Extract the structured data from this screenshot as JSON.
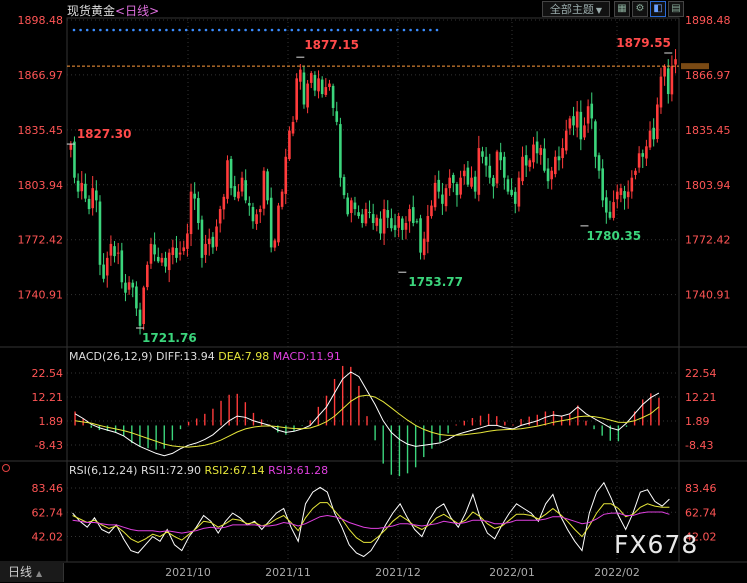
{
  "header": {
    "title": "现货黄金",
    "period": "<日线>",
    "theme_button": "全部主题",
    "bottom_tab": "日线"
  },
  "watermark": "FX678",
  "colors": {
    "up": "#ff3b3b",
    "down": "#3bd57c",
    "axis_text": "#ff5555",
    "grid": "#333333",
    "dif": "#ffffff",
    "dea": "#e6e63a",
    "macd": "#e040e0",
    "rsi1": "#ffffff",
    "rsi2": "#e6e63a",
    "rsi3": "#e040e0",
    "ref_line": "#ff9a3a",
    "dots": "#3a8cff"
  },
  "chart_data": [
    {
      "type": "candlestick",
      "title": "现货黄金",
      "period": "日线",
      "y_ticks": [
        "1898.48",
        "1866.97",
        "1835.45",
        "1803.94",
        "1772.42",
        "1740.91"
      ],
      "ylim": [
        1712,
        1898.48
      ],
      "x_ticks": [
        "2021/10",
        "2021/11",
        "2021/12",
        "2022/01",
        "2022/02"
      ],
      "current_price_line": 1872,
      "annotations": [
        {
          "text": "1827.30",
          "kind": "high"
        },
        {
          "text": "1877.15",
          "kind": "high"
        },
        {
          "text": "1879.55",
          "kind": "high"
        },
        {
          "text": "1721.76",
          "kind": "low"
        },
        {
          "text": "1753.77",
          "kind": "low"
        },
        {
          "text": "1780.35",
          "kind": "low"
        }
      ],
      "closes": [
        1827,
        1808,
        1800,
        1805,
        1796,
        1790,
        1802,
        1795,
        1758,
        1750,
        1762,
        1770,
        1763,
        1765,
        1748,
        1742,
        1748,
        1745,
        1733,
        1723,
        1745,
        1758,
        1770,
        1764,
        1760,
        1762,
        1757,
        1765,
        1768,
        1762,
        1765,
        1768,
        1776,
        1800,
        1796,
        1782,
        1762,
        1770,
        1773,
        1768,
        1780,
        1790,
        1797,
        1818,
        1802,
        1797,
        1800,
        1808,
        1795,
        1792,
        1783,
        1787,
        1790,
        1812,
        1795,
        1768,
        1772,
        1792,
        1800,
        1820,
        1835,
        1840,
        1865,
        1870,
        1850,
        1862,
        1868,
        1858,
        1865,
        1856,
        1860,
        1862,
        1848,
        1840,
        1808,
        1798,
        1787,
        1795,
        1790,
        1786,
        1782,
        1790,
        1788,
        1782,
        1785,
        1776,
        1790,
        1785,
        1779,
        1778,
        1786,
        1778,
        1782,
        1790,
        1782,
        1783,
        1765,
        1773,
        1786,
        1792,
        1805,
        1800,
        1793,
        1802,
        1808,
        1805,
        1798,
        1808,
        1812,
        1804,
        1808,
        1800,
        1825,
        1820,
        1815,
        1808,
        1803,
        1823,
        1818,
        1808,
        1800,
        1798,
        1793,
        1808,
        1820,
        1815,
        1818,
        1827,
        1822,
        1825,
        1812,
        1806,
        1812,
        1820,
        1818,
        1825,
        1835,
        1842,
        1838,
        1846,
        1830,
        1838,
        1849,
        1842,
        1820,
        1812,
        1795,
        1788,
        1785,
        1794,
        1800,
        1802,
        1796,
        1800,
        1808,
        1812,
        1822,
        1820,
        1826,
        1835,
        1830,
        1850,
        1866,
        1872,
        1856,
        1872,
        1876
      ]
    },
    {
      "type": "line",
      "title": "MACD(26,12,9)",
      "values_text": {
        "dif": "DIFF:13.94",
        "dea": "DEA:7.98",
        "macd": "MACD:11.91"
      },
      "y_ticks": [
        "22.54",
        "12.21",
        "1.89",
        "-8.43"
      ],
      "ylim": [
        -14,
        26
      ],
      "series": [
        {
          "name": "DIFF",
          "values": [
            5.0,
            3.0,
            0.5,
            -1.0,
            -2.0,
            -3.0,
            -4.5,
            -7.0,
            -9.0,
            -10.5,
            -12.0,
            -13.0,
            -12.0,
            -10.0,
            -8.5,
            -7.5,
            -6.0,
            -4.0,
            -1.0,
            2.0,
            4.0,
            3.5,
            2.0,
            1.0,
            0.0,
            -2.0,
            -3.0,
            -2.5,
            -1.5,
            0.0,
            4.0,
            8.0,
            14.0,
            20.0,
            23.0,
            21.0,
            15.0,
            9.0,
            2.0,
            -3.0,
            -6.0,
            -8.0,
            -9.0,
            -8.5,
            -8.0,
            -7.5,
            -6.0,
            -4.0,
            -3.0,
            -2.0,
            -1.0,
            0.0,
            0.0,
            -1.0,
            -1.5,
            0.0,
            1.0,
            2.0,
            3.5,
            4.5,
            4.0,
            5.0,
            8.0,
            5.0,
            3.0,
            1.0,
            -1.0,
            -2.0,
            1.0,
            5.0,
            9.0,
            12.0,
            13.9
          ]
        },
        {
          "name": "DEA",
          "values": [
            2.0,
            1.5,
            1.0,
            0.0,
            -0.8,
            -1.5,
            -2.2,
            -3.2,
            -4.4,
            -5.6,
            -6.8,
            -8.0,
            -8.8,
            -9.2,
            -9.3,
            -9.0,
            -8.5,
            -7.6,
            -6.3,
            -4.6,
            -2.8,
            -1.5,
            -0.7,
            -0.3,
            -0.2,
            -0.5,
            -1.0,
            -1.3,
            -1.4,
            -1.1,
            0.0,
            1.6,
            4.0,
            7.2,
            10.4,
            12.5,
            13.0,
            12.2,
            10.2,
            7.6,
            4.9,
            2.3,
            0.0,
            -1.7,
            -3.0,
            -3.9,
            -4.3,
            -4.2,
            -4.0,
            -3.6,
            -3.1,
            -2.5,
            -2.0,
            -1.8,
            -1.7,
            -1.4,
            -0.9,
            -0.3,
            0.5,
            1.4,
            2.0,
            2.6,
            3.7,
            4.0,
            3.8,
            3.2,
            2.3,
            1.4,
            1.3,
            2.0,
            3.4,
            5.1,
            8.0
          ]
        }
      ],
      "histogram": [
        6.0,
        3.0,
        -1.0,
        -2.0,
        -2.4,
        -3.0,
        -4.6,
        -7.6,
        -9.2,
        -9.8,
        -10.4,
        -10.0,
        -6.4,
        -1.6,
        1.6,
        3.0,
        5.0,
        7.2,
        10.6,
        13.2,
        13.6,
        10.0,
        5.4,
        2.6,
        0.4,
        -3.0,
        -4.0,
        -2.4,
        -0.2,
        2.2,
        8.0,
        12.8,
        20.0,
        25.6,
        25.2,
        17.0,
        4.0,
        -6.4,
        -16.4,
        -21.2,
        -21.8,
        -20.6,
        -18.0,
        -13.6,
        -10.0,
        -7.2,
        -3.4,
        0.4,
        2.0,
        3.2,
        4.2,
        5.0,
        4.0,
        1.6,
        0.4,
        2.8,
        3.8,
        4.6,
        6.0,
        6.2,
        4.0,
        4.8,
        8.6,
        2.0,
        -1.6,
        -4.4,
        -6.6,
        -6.8,
        -0.6,
        6.0,
        11.2,
        13.8,
        11.9
      ]
    },
    {
      "type": "line",
      "title": "RSI(6,12,24)",
      "values_text": {
        "rsi1": "RSI1:72.90",
        "rsi2": "RSI2:67.14",
        "rsi3": "RSI3:61.28"
      },
      "y_ticks": [
        "83.46",
        "62.74",
        "42.02"
      ],
      "ylim": [
        22,
        92
      ],
      "series": [
        {
          "name": "RSI1",
          "values": [
            62,
            55,
            50,
            58,
            48,
            45,
            52,
            40,
            30,
            28,
            35,
            42,
            38,
            48,
            35,
            30,
            42,
            50,
            60,
            55,
            45,
            55,
            62,
            58,
            52,
            55,
            48,
            55,
            62,
            66,
            50,
            38,
            70,
            80,
            84,
            80,
            62,
            50,
            35,
            28,
            25,
            30,
            40,
            52,
            62,
            70,
            58,
            48,
            42,
            56,
            66,
            70,
            58,
            50,
            62,
            78,
            58,
            45,
            40,
            52,
            62,
            70,
            66,
            62,
            55,
            70,
            78,
            60,
            48,
            38,
            30,
            62,
            80,
            88,
            75,
            60,
            48,
            62,
            80,
            82,
            72,
            68,
            74
          ]
        },
        {
          "name": "RSI2",
          "values": [
            60,
            57,
            54,
            56,
            52,
            49,
            51,
            46,
            40,
            37,
            40,
            44,
            42,
            46,
            42,
            39,
            44,
            49,
            55,
            54,
            50,
            53,
            57,
            56,
            53,
            54,
            51,
            53,
            57,
            60,
            54,
            47,
            58,
            66,
            71,
            71,
            64,
            57,
            48,
            41,
            37,
            37,
            42,
            48,
            55,
            60,
            56,
            51,
            48,
            52,
            58,
            61,
            57,
            53,
            56,
            63,
            59,
            53,
            49,
            51,
            56,
            61,
            61,
            60,
            57,
            61,
            66,
            61,
            55,
            48,
            42,
            51,
            62,
            70,
            70,
            66,
            59,
            61,
            67,
            70,
            68,
            67,
            67
          ]
        },
        {
          "name": "RSI3",
          "values": [
            56,
            55,
            54,
            54,
            53,
            52,
            52,
            50,
            48,
            47,
            47,
            47,
            46,
            47,
            46,
            45,
            46,
            47,
            49,
            50,
            49,
            50,
            52,
            52,
            52,
            52,
            51,
            51,
            52,
            54,
            53,
            51,
            53,
            56,
            59,
            60,
            59,
            57,
            54,
            52,
            50,
            49,
            49,
            50,
            51,
            53,
            53,
            52,
            51,
            52,
            53,
            55,
            54,
            53,
            54,
            56,
            56,
            55,
            53,
            53,
            54,
            56,
            56,
            56,
            56,
            57,
            59,
            59,
            57,
            55,
            53,
            54,
            57,
            61,
            62,
            62,
            60,
            60,
            62,
            63,
            63,
            63,
            61
          ]
        }
      ]
    }
  ]
}
